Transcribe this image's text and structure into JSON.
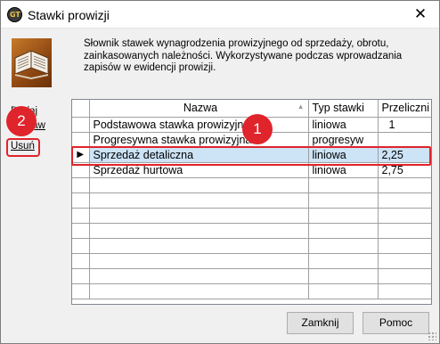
{
  "window": {
    "title": "Stawki prowizji",
    "close_glyph": "✕",
    "app_icon_letters": "GT"
  },
  "description": "Słownik stawek wynagrodzenia prowizyjnego od sprzedaży, obrotu, zainkasowanych należności. Wykorzystywane podczas wprowadzania zapisów w ewidencji prowizji.",
  "actions": {
    "add": "Dodaj",
    "edit": "Popraw",
    "delete": "Usuń"
  },
  "grid": {
    "columns": [
      "Nazwa",
      "Typ stawki",
      "Przeliczni"
    ],
    "current_row_indicator": "▶",
    "sort_indicator": "▲",
    "rows": [
      {
        "name": "Podstawowa stawka prowizyjna",
        "type": "liniowa",
        "multiplier": "1"
      },
      {
        "name": "Progresywna stawka prowizyjna",
        "type": "progresyw",
        "multiplier": ""
      },
      {
        "name": "Sprzedaż detaliczna",
        "type": "liniowa",
        "multiplier": "2,25"
      },
      {
        "name": "Sprzedaż hurtowa",
        "type": "liniowa",
        "multiplier": "2,75"
      }
    ],
    "selected_row": 2
  },
  "annotations": {
    "badge_1": "1",
    "badge_2": "2",
    "color": "#e0242b"
  },
  "buttons": {
    "close": "Zamknij",
    "help": "Pomoc"
  },
  "colors": {
    "selection": "#cde3f6",
    "book_icon": "#a85a1c"
  }
}
